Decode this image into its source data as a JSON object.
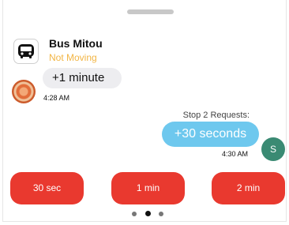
{
  "header": {
    "bus_name": "Bus Mitou",
    "status": "Not Moving",
    "bus_icon": "bus-icon",
    "status_color": "#f2b544"
  },
  "messages": {
    "incoming": {
      "text": "+1 minute",
      "time": "4:28 AM"
    },
    "outgoing": {
      "label": "Stop 2 Requests:",
      "text": "+30 seconds",
      "time": "4:30 AM",
      "avatar_initial": "S",
      "bubble_color": "#6ec8ee"
    }
  },
  "quick_replies": [
    {
      "label": "30 sec"
    },
    {
      "label": "1 min"
    },
    {
      "label": "2 min"
    }
  ],
  "accent_color": "#e9392f",
  "pager": {
    "pages": 3,
    "current": 2
  }
}
